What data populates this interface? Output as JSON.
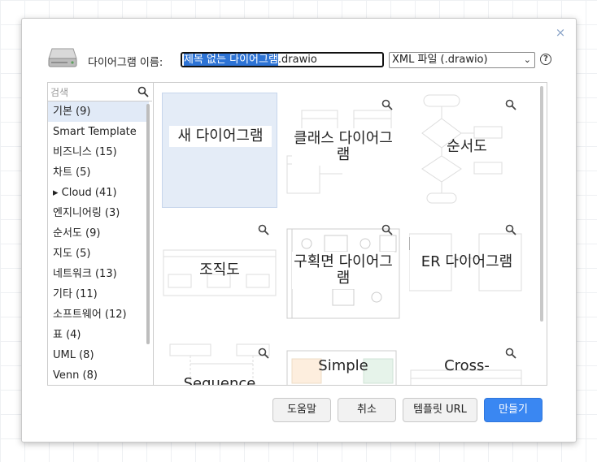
{
  "dialog": {
    "close_glyph": "×",
    "name_label": "다이어그램 이름:",
    "filename_selected": "제목 없는 다이어그램",
    "filename_ext": ".drawio",
    "format_selected": "XML 파일 (.drawio)",
    "help_glyph": "?"
  },
  "search": {
    "placeholder": "검색"
  },
  "categories": [
    "기본 (9)",
    "Smart Template",
    "비즈니스 (15)",
    "차트 (5)",
    "▸ Cloud (41)",
    "엔지니어링 (3)",
    "순서도 (9)",
    "지도 (5)",
    "네트워크 (13)",
    "기타 (11)",
    "소프트웨어 (12)",
    "표 (4)",
    "UML (8)",
    "Venn (8)"
  ],
  "templates": [
    "새 다이어그램",
    "클래스 다이어그램",
    "순서도",
    "조직도",
    "구획면 다이어그램",
    "ER 다이어그램",
    "Sequence",
    "Simple",
    "Cross-"
  ],
  "buttons": {
    "help": "도움말",
    "cancel": "취소",
    "template_url": "템플릿 URL",
    "create": "만들기"
  },
  "colors": {
    "accent": "#3a87f2",
    "selection": "#2d73d5",
    "selected_tile": "#e4ecf7"
  }
}
